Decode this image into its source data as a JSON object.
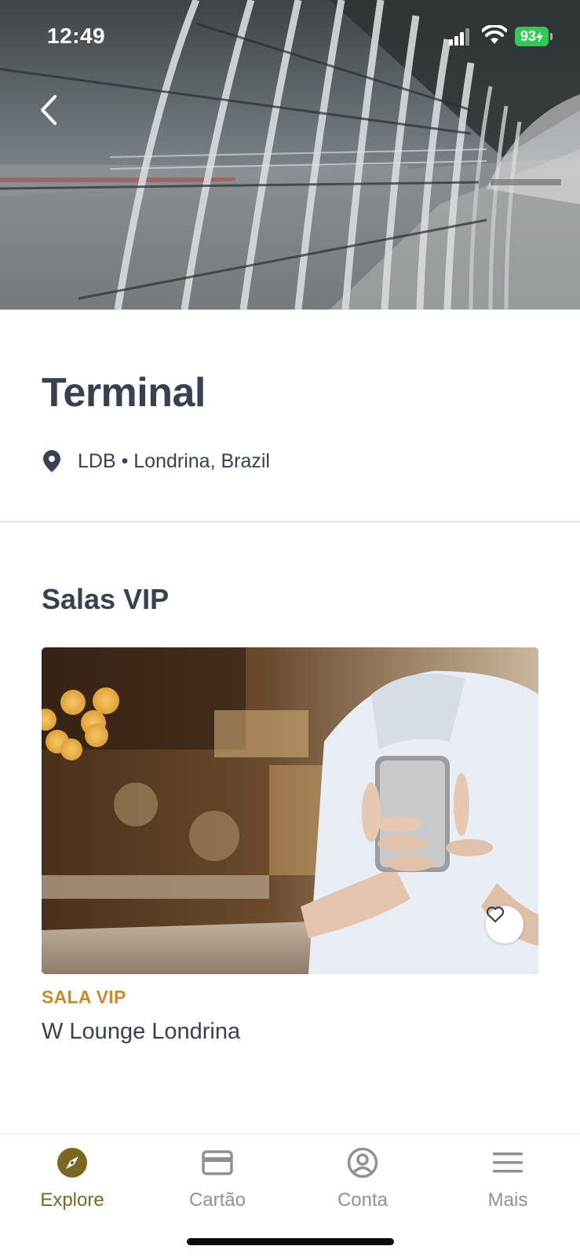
{
  "status_bar": {
    "time": "12:49",
    "battery": "93"
  },
  "terminal": {
    "title": "Terminal",
    "location": "LDB • Londrina, Brazil"
  },
  "section": {
    "title": "Salas VIP"
  },
  "lounge_card": {
    "type_label": "SALA VIP",
    "name": "W Lounge Londrina"
  },
  "tab_bar": {
    "tabs": [
      {
        "label": "Explore",
        "icon": "compass-icon",
        "active": true
      },
      {
        "label": "Cartão",
        "icon": "card-icon",
        "active": false
      },
      {
        "label": "Conta",
        "icon": "account-icon",
        "active": false
      },
      {
        "label": "Mais",
        "icon": "menu-icon",
        "active": false
      }
    ]
  },
  "colors": {
    "text": "#364152",
    "accent_orange": "#c98a2e",
    "active_tab": "#7a6720",
    "inactive_tab": "#8e9297",
    "battery": "#35c759"
  }
}
